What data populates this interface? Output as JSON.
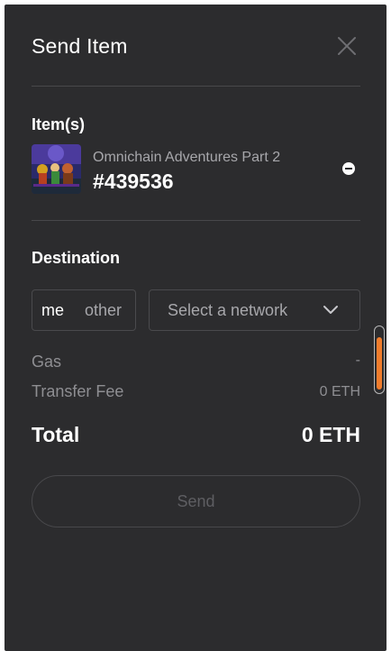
{
  "dialog": {
    "title": "Send Item",
    "close_icon": "close-icon"
  },
  "items_section": {
    "label": "Item(s)",
    "items": [
      {
        "collection": "Omnichain Adventures Part 2",
        "token_id": "#439536",
        "remove_icon": "minus-circle-icon"
      }
    ]
  },
  "destination": {
    "label": "Destination",
    "toggle": {
      "options": [
        "me",
        "other"
      ],
      "selected": "me"
    },
    "network_select": {
      "placeholder": "Select a network",
      "icon": "chevron-down-icon"
    }
  },
  "fees": {
    "gas_label": "Gas",
    "gas_value": "-",
    "transfer_fee_label": "Transfer Fee",
    "transfer_fee_value": "0 ETH"
  },
  "total": {
    "label": "Total",
    "value": "0 ETH"
  },
  "actions": {
    "send_label": "Send"
  },
  "colors": {
    "panel_background": "#2c2c2e",
    "scrollbar_accent": "#f07c2c",
    "muted_text": "#8e8e92"
  }
}
